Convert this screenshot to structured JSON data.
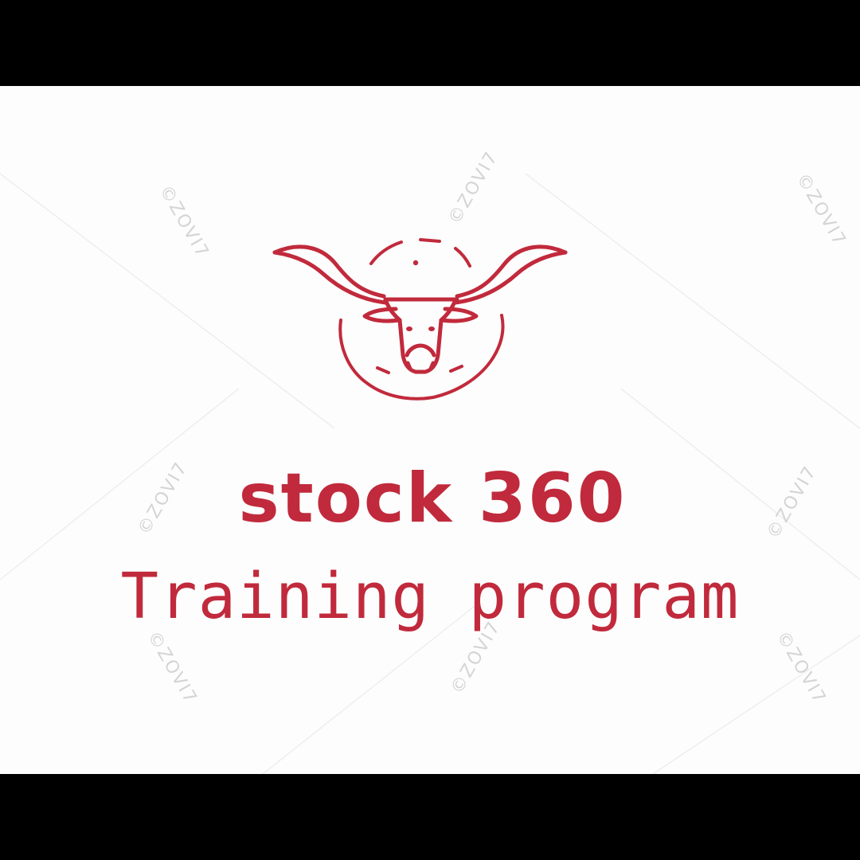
{
  "logo": {
    "brand_name": "stock 360",
    "tagline": "Training program",
    "emblem_icon": "longhorn-bull-icon"
  },
  "watermark": {
    "text": "©ZOVI7",
    "instances": [
      "©ZOVI7",
      "©ZOVI7",
      "©ZOVI7",
      "©ZOVI7",
      "©ZOVI7",
      "©ZOVI7",
      "©ZOVI7",
      "©ZOVI7"
    ]
  },
  "colors": {
    "brand": "#c12a3c",
    "background": "#fdfdfd",
    "letterbox": "#000000",
    "watermark": "#d8d8d8"
  }
}
